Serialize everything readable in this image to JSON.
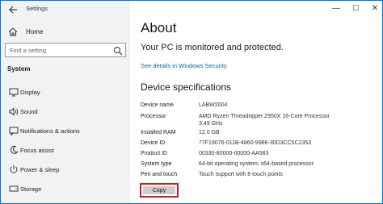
{
  "window": {
    "title": "Settings",
    "controls": {
      "minimize": "—",
      "maximize": "☐",
      "close": "✕"
    }
  },
  "sidebar": {
    "home_label": "Home",
    "search_placeholder": "Find a setting",
    "section_label": "System",
    "items": [
      {
        "label": "Display",
        "icon": "display-icon"
      },
      {
        "label": "Sound",
        "icon": "sound-icon"
      },
      {
        "label": "Notifications & actions",
        "icon": "notifications-icon"
      },
      {
        "label": "Focus assist",
        "icon": "focus-assist-icon"
      },
      {
        "label": "Power & sleep",
        "icon": "power-icon"
      },
      {
        "label": "Storage",
        "icon": "storage-icon"
      }
    ]
  },
  "main": {
    "title": "About",
    "protection_text": "Your PC is monitored and protected.",
    "security_link": "See details in Windows Security",
    "specs_title": "Device specifications",
    "specs": [
      {
        "key": "Device name",
        "value": "LABW2004"
      },
      {
        "key": "Processor",
        "value": "AMD Ryzen Threadripper 2950X 16-Core Processor 3.49 GHz"
      },
      {
        "key": "Installed RAM",
        "value": "12.0 GB"
      },
      {
        "key": "Device ID",
        "value": "77F19076-011B-4860-9986-30D3CC5C2353"
      },
      {
        "key": "Product ID",
        "value": "00330-80000-00000-AA583"
      },
      {
        "key": "System type",
        "value": "64-bit operating system, x64-based processor"
      },
      {
        "key": "Pen and touch",
        "value": "Touch support with 8 touch points"
      }
    ],
    "copy_label": "Copy"
  },
  "colors": {
    "accent": "#0078d4",
    "link": "#0066b4",
    "highlight_border": "#d11a1a",
    "sidebar_bg": "#f2f2f2",
    "button_bg": "#cccccc"
  }
}
